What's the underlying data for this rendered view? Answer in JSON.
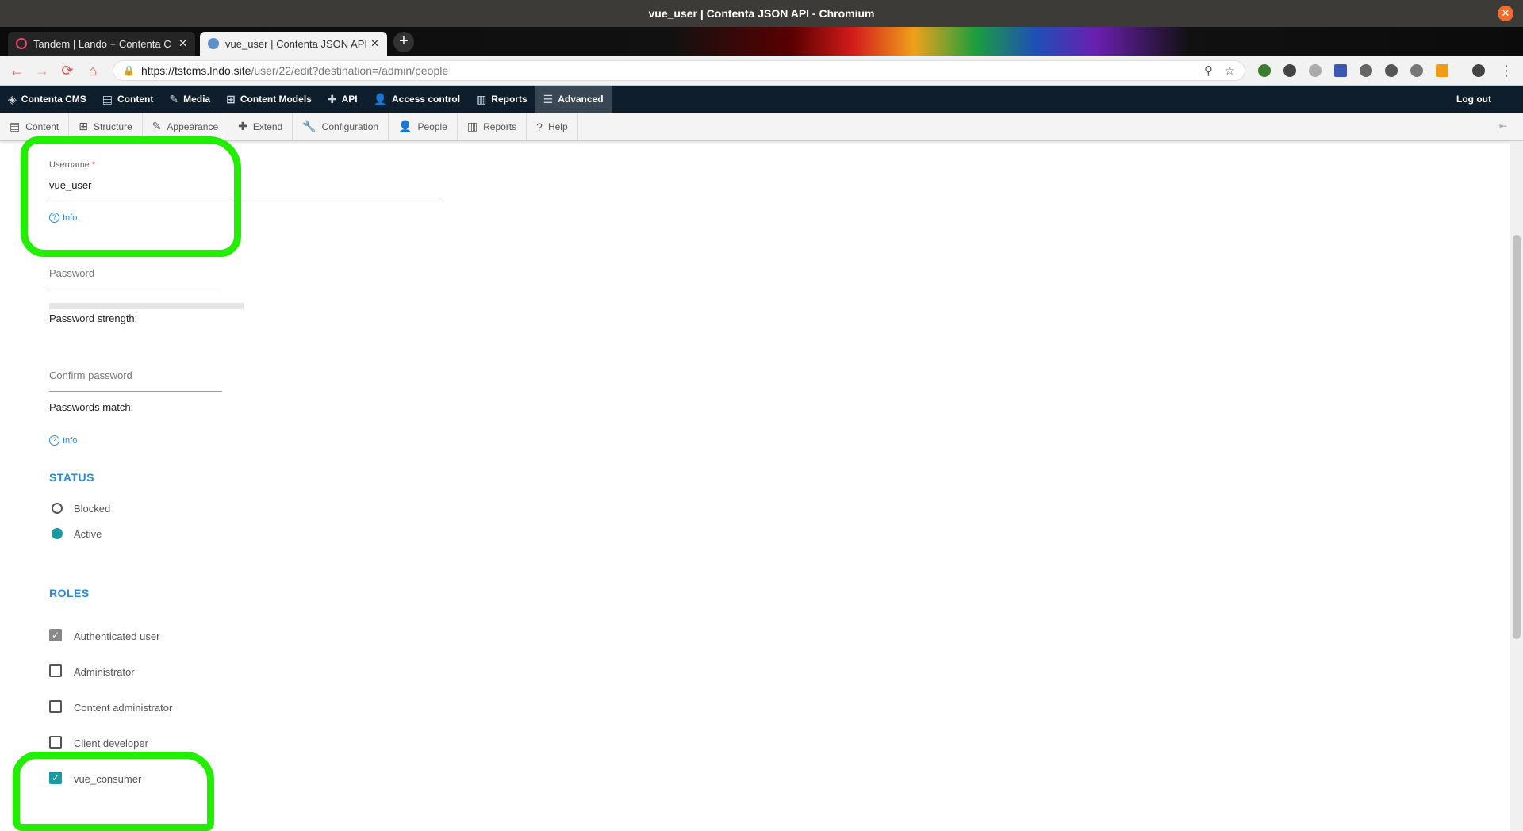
{
  "window": {
    "title": "vue_user | Contenta JSON API - Chromium"
  },
  "tabs": [
    {
      "title": "Tandem | Lando + Contenta C",
      "active": false
    },
    {
      "title": "vue_user | Contenta JSON API",
      "active": true
    }
  ],
  "address": {
    "host": "https://tstcms.lndo.site",
    "path": "/user/22/edit?destination=/admin/people"
  },
  "admin_toolbar": {
    "items": [
      {
        "label": "Contenta CMS",
        "icon": "contenta-logo-icon"
      },
      {
        "label": "Content",
        "icon": "file-icon"
      },
      {
        "label": "Media",
        "icon": "media-icon"
      },
      {
        "label": "Content Models",
        "icon": "sitemap-icon"
      },
      {
        "label": "API",
        "icon": "puzzle-icon"
      },
      {
        "label": "Access control",
        "icon": "user-icon"
      },
      {
        "label": "Reports",
        "icon": "bar-chart-icon"
      },
      {
        "label": "Advanced",
        "icon": "menu-icon"
      }
    ],
    "logout": "Log out"
  },
  "tray": {
    "items": [
      {
        "label": "Content",
        "icon": "file-icon"
      },
      {
        "label": "Structure",
        "icon": "sitemap-icon"
      },
      {
        "label": "Appearance",
        "icon": "brush-icon"
      },
      {
        "label": "Extend",
        "icon": "puzzle-icon"
      },
      {
        "label": "Configuration",
        "icon": "wrench-icon"
      },
      {
        "label": "People",
        "icon": "user-icon"
      },
      {
        "label": "Reports",
        "icon": "bar-chart-icon"
      },
      {
        "label": "Help",
        "icon": "help-icon"
      }
    ]
  },
  "form": {
    "username_label": "Username",
    "username_required": "*",
    "username_value": "vue_user",
    "info_label": "Info",
    "password_placeholder": "Password",
    "password_strength": "Password strength:",
    "confirm_placeholder": "Confirm password",
    "passwords_match": "Passwords match:",
    "status_title": "STATUS",
    "status_options": [
      {
        "label": "Blocked",
        "selected": false
      },
      {
        "label": "Active",
        "selected": true
      }
    ],
    "roles_title": "ROLES",
    "roles": [
      {
        "label": "Authenticated user",
        "checked": true,
        "disabled": true
      },
      {
        "label": "Administrator",
        "checked": false
      },
      {
        "label": "Content administrator",
        "checked": false
      },
      {
        "label": "Client developer",
        "checked": false
      },
      {
        "label": "vue_consumer",
        "checked": true
      }
    ]
  },
  "colors": {
    "accent": "#2a8ad4",
    "checked": "#1a9aa1",
    "annotation": "#21ee00",
    "toolbar": "#0f1e2d"
  }
}
